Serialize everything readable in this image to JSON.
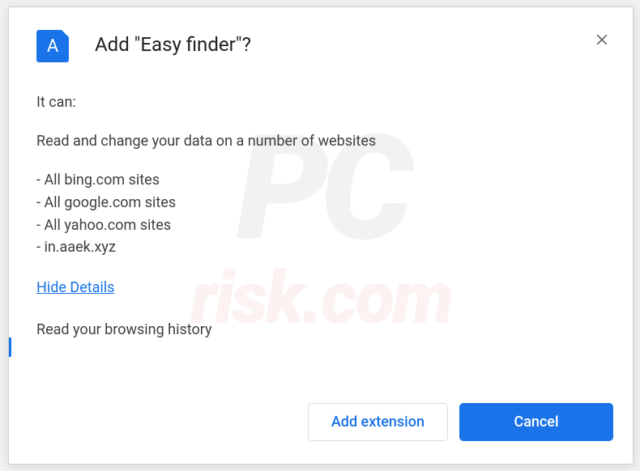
{
  "dialog": {
    "title": "Add \"Easy finder\"?",
    "iconLetter": "A",
    "itCan": "It can:",
    "permissions": {
      "readChange": "Read and change your data on a number of websites",
      "sites": [
        "- All bing.com sites",
        "- All google.com sites",
        "- All yahoo.com sites",
        "- in.aaek.xyz"
      ],
      "history": "Read your browsing history"
    },
    "hideDetails": "Hide Details",
    "buttons": {
      "add": "Add extension",
      "cancel": "Cancel"
    }
  },
  "watermark": {
    "top": "PC",
    "bottom": "risk.com"
  }
}
